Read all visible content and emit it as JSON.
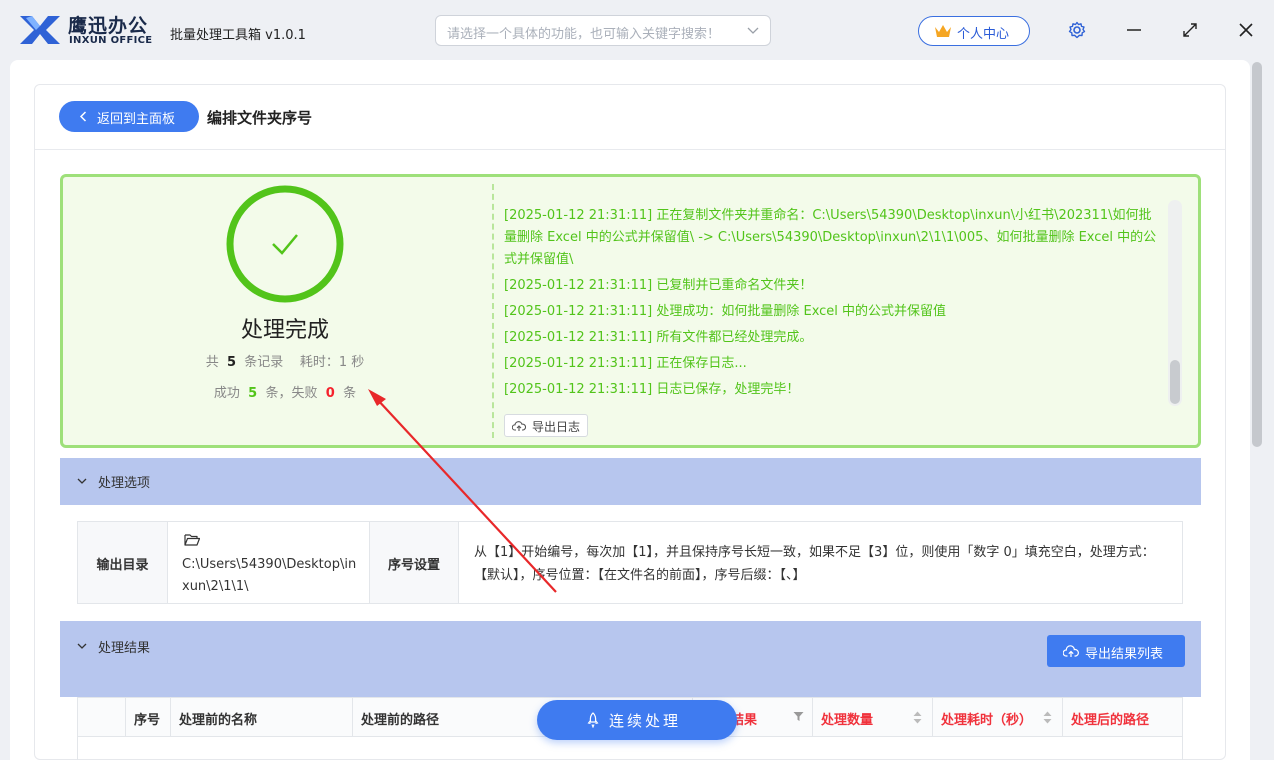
{
  "app": {
    "brand_cn": "鹰迅办公",
    "brand_en": "INXUN OFFICE",
    "title": "批量处理工具箱 v1.0.1",
    "search_placeholder": "请选择一个具体的功能，也可输入关键字搜索！",
    "user_center_label": "个人中心"
  },
  "page": {
    "back_label": "返回到主面板",
    "title": "编排文件夹序号"
  },
  "status": {
    "title": "处理完成",
    "stats1": {
      "prefix": "共",
      "count": "5",
      "unit": "条记录",
      "time_label": "耗时：",
      "time_value": "1",
      "time_unit": "秒"
    },
    "stats2": {
      "success_label": "成功",
      "success": "5",
      "mid": "条，失败",
      "fail": "0",
      "unit": "条"
    },
    "log": [
      "[2025-01-12 21:31:11] 正在复制文件夹并重命名：C:\\Users\\54390\\Desktop\\inxun\\小红书\\202311\\如何批量删除 Excel 中的公式并保留值\\ -> C:\\Users\\54390\\Desktop\\inxun\\2\\1\\1\\005、如何批量删除 Excel 中的公式并保留值\\",
      "[2025-01-12 21:31:11] 已复制并已重命名文件夹！",
      "[2025-01-12 21:31:11] 处理成功：如何批量删除 Excel 中的公式并保留值",
      "[2025-01-12 21:31:11] 所有文件都已经处理完成。",
      "[2025-01-12 21:31:11] 正在保存日志...",
      "[2025-01-12 21:31:11] 日志已保存，处理完毕！"
    ],
    "export_log_label": "导出日志"
  },
  "options": {
    "section_label": "处理选项",
    "output_dir_label": "输出目录",
    "output_dir_value": "C:\\Users\\54390\\Desktop\\inxun\\2\\1\\1\\",
    "serial_label": "序号设置",
    "serial_desc": "从【1】开始编号，每次加【1】，并且保持序号长短一致，如果不足【3】位，则使用「数字 0」填充空白，处理方式：【默认】，序号位置：【在文件名的前面】，序号后缀：【、】"
  },
  "results": {
    "section_label": "处理结果",
    "export_label": "导出结果列表",
    "columns": [
      "序号",
      "处理前的名称",
      "处理前的路径",
      "结果",
      "处理数量",
      "处理耗时（秒）",
      "处理后的路径"
    ]
  },
  "continue_label": "连续处理",
  "colors": {
    "accent": "#3f7bf0",
    "success": "#52c41a",
    "fail": "#f5222d",
    "header_red": "#f0323c"
  }
}
